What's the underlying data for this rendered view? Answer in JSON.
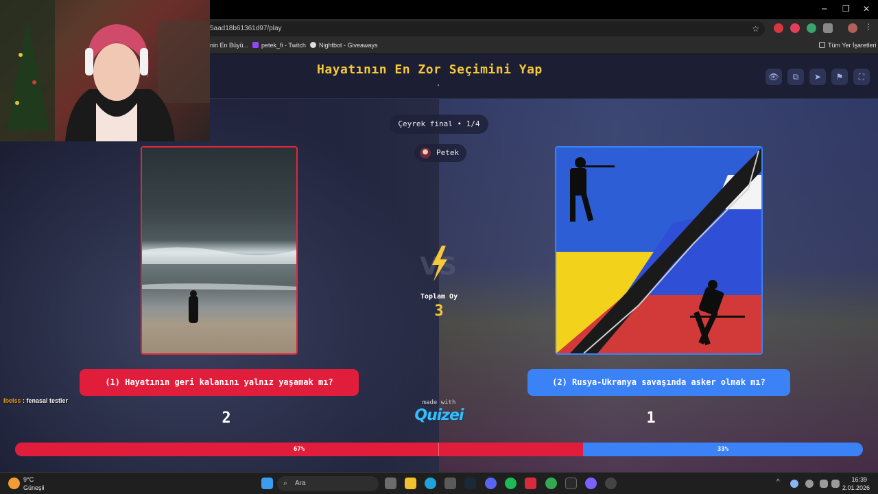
{
  "browser": {
    "url": "5aad18b61361d97/play",
    "bookmarks": [
      "nin En Büyü...",
      "petek_fi - Twitch",
      "Nightbot - Giveaways"
    ],
    "all_bookmarks": "Tüm Yer İşaretleri",
    "window_controls": [
      "─",
      "❐",
      "✕"
    ]
  },
  "header": {
    "title": "Hayatının En Zor Seçimini Yap",
    "buttons": [
      "eye-icon",
      "share-icon",
      "send-icon",
      "flag-icon",
      "fullscreen-icon"
    ]
  },
  "match": {
    "round": "Çeyrek final • 1/4",
    "user": "Petek",
    "total_label": "Toplam Oy",
    "total_votes": "3",
    "vs": "VS",
    "made_with": "made with",
    "brand": "Quizei"
  },
  "options": [
    {
      "label": "(1) Hayatının geri kalanını yalnız yaşamak mı?",
      "votes": "2",
      "percent_text": "67%",
      "color": "#e11d3c"
    },
    {
      "label": "(2) Rusya-Ukranya savaşında asker olmak mı?",
      "votes": "1",
      "percent_text": "33%",
      "color": "#3b82f6"
    }
  ],
  "progress": {
    "left_fraction": 0.67
  },
  "chat": {
    "user": "lbelss",
    "sep": " : ",
    "message": "fenasal testler"
  },
  "taskbar": {
    "weather_temp": "9°C",
    "weather_desc": "Güneşli",
    "search_placeholder": "Ara",
    "time": "16:39",
    "date": "2.01.2026"
  }
}
